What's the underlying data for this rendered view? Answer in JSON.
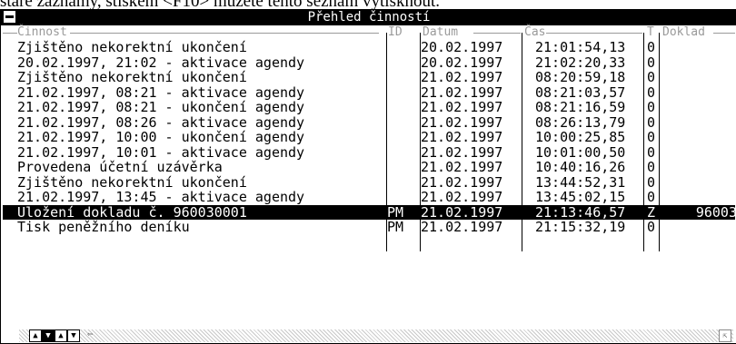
{
  "instruction_text": "staré záznamy, stiskem <F10> můžete tento seznam vytisknout.",
  "window": {
    "title": "Přehled činností"
  },
  "columns": {
    "cinnost": "Činnost",
    "id": "ID",
    "datum": "Datum",
    "cas": "Čas",
    "t": "T",
    "doklad": "Doklad"
  },
  "rows": [
    {
      "cinnost": "Zjištěno nekorektní ukončení",
      "id": "",
      "datum": "20.02.1997",
      "cas": "21:01:54,13",
      "t": "0",
      "doklad": ""
    },
    {
      "cinnost": "20.02.1997, 21:02 - aktivace agendy",
      "id": "",
      "datum": "20.02.1997",
      "cas": "21:02:20,33",
      "t": "0",
      "doklad": ""
    },
    {
      "cinnost": "Zjištěno nekorektní ukončení",
      "id": "",
      "datum": "21.02.1997",
      "cas": "08:20:59,18",
      "t": "0",
      "doklad": ""
    },
    {
      "cinnost": "21.02.1997, 08:21 - aktivace agendy",
      "id": "",
      "datum": "21.02.1997",
      "cas": "08:21:03,57",
      "t": "0",
      "doklad": ""
    },
    {
      "cinnost": "21.02.1997, 08:21 - ukončení agendy",
      "id": "",
      "datum": "21.02.1997",
      "cas": "08:21:16,59",
      "t": "0",
      "doklad": ""
    },
    {
      "cinnost": "21.02.1997, 08:26 - aktivace agendy",
      "id": "",
      "datum": "21.02.1997",
      "cas": "08:26:13,79",
      "t": "0",
      "doklad": ""
    },
    {
      "cinnost": "21.02.1997, 10:00 - ukončení agendy",
      "id": "",
      "datum": "21.02.1997",
      "cas": "10:00:25,85",
      "t": "0",
      "doklad": ""
    },
    {
      "cinnost": "21.02.1997, 10:01 - aktivace agendy",
      "id": "",
      "datum": "21.02.1997",
      "cas": "10:01:00,50",
      "t": "0",
      "doklad": ""
    },
    {
      "cinnost": "Provedena účetní uzávěrka",
      "id": "",
      "datum": "21.02.1997",
      "cas": "10:40:16,26",
      "t": "0",
      "doklad": ""
    },
    {
      "cinnost": "Zjištěno nekorektní ukončení",
      "id": "",
      "datum": "21.02.1997",
      "cas": "13:44:52,31",
      "t": "0",
      "doklad": ""
    },
    {
      "cinnost": "21.02.1997, 13:45 - aktivace agendy",
      "id": "",
      "datum": "21.02.1997",
      "cas": "13:45:02,15",
      "t": "0",
      "doklad": ""
    },
    {
      "cinnost": "Uložení dokladu č. 960030001",
      "id": "PM",
      "datum": "21.02.1997",
      "cas": "21:13:46,57",
      "t": "Z",
      "doklad": "96003"
    },
    {
      "cinnost": "Tisk peněžního deníku",
      "id": "PM",
      "datum": "21.02.1997",
      "cas": "21:15:32,19",
      "t": "0",
      "doklad": ""
    }
  ],
  "selected_row_index": 11,
  "icons": {
    "system_menu": "system-menu-icon",
    "nav": [
      "arrow-up-first-icon",
      "arrow-down-last-icon",
      "arrow-up-icon",
      "arrow-down-icon"
    ],
    "filter": "filter-icon",
    "resize": "resize-grip-icon"
  },
  "colors": {
    "titlebar_bg": "#000000",
    "header_text": "#9a9a9a",
    "selected_row_bg": "#000000"
  }
}
